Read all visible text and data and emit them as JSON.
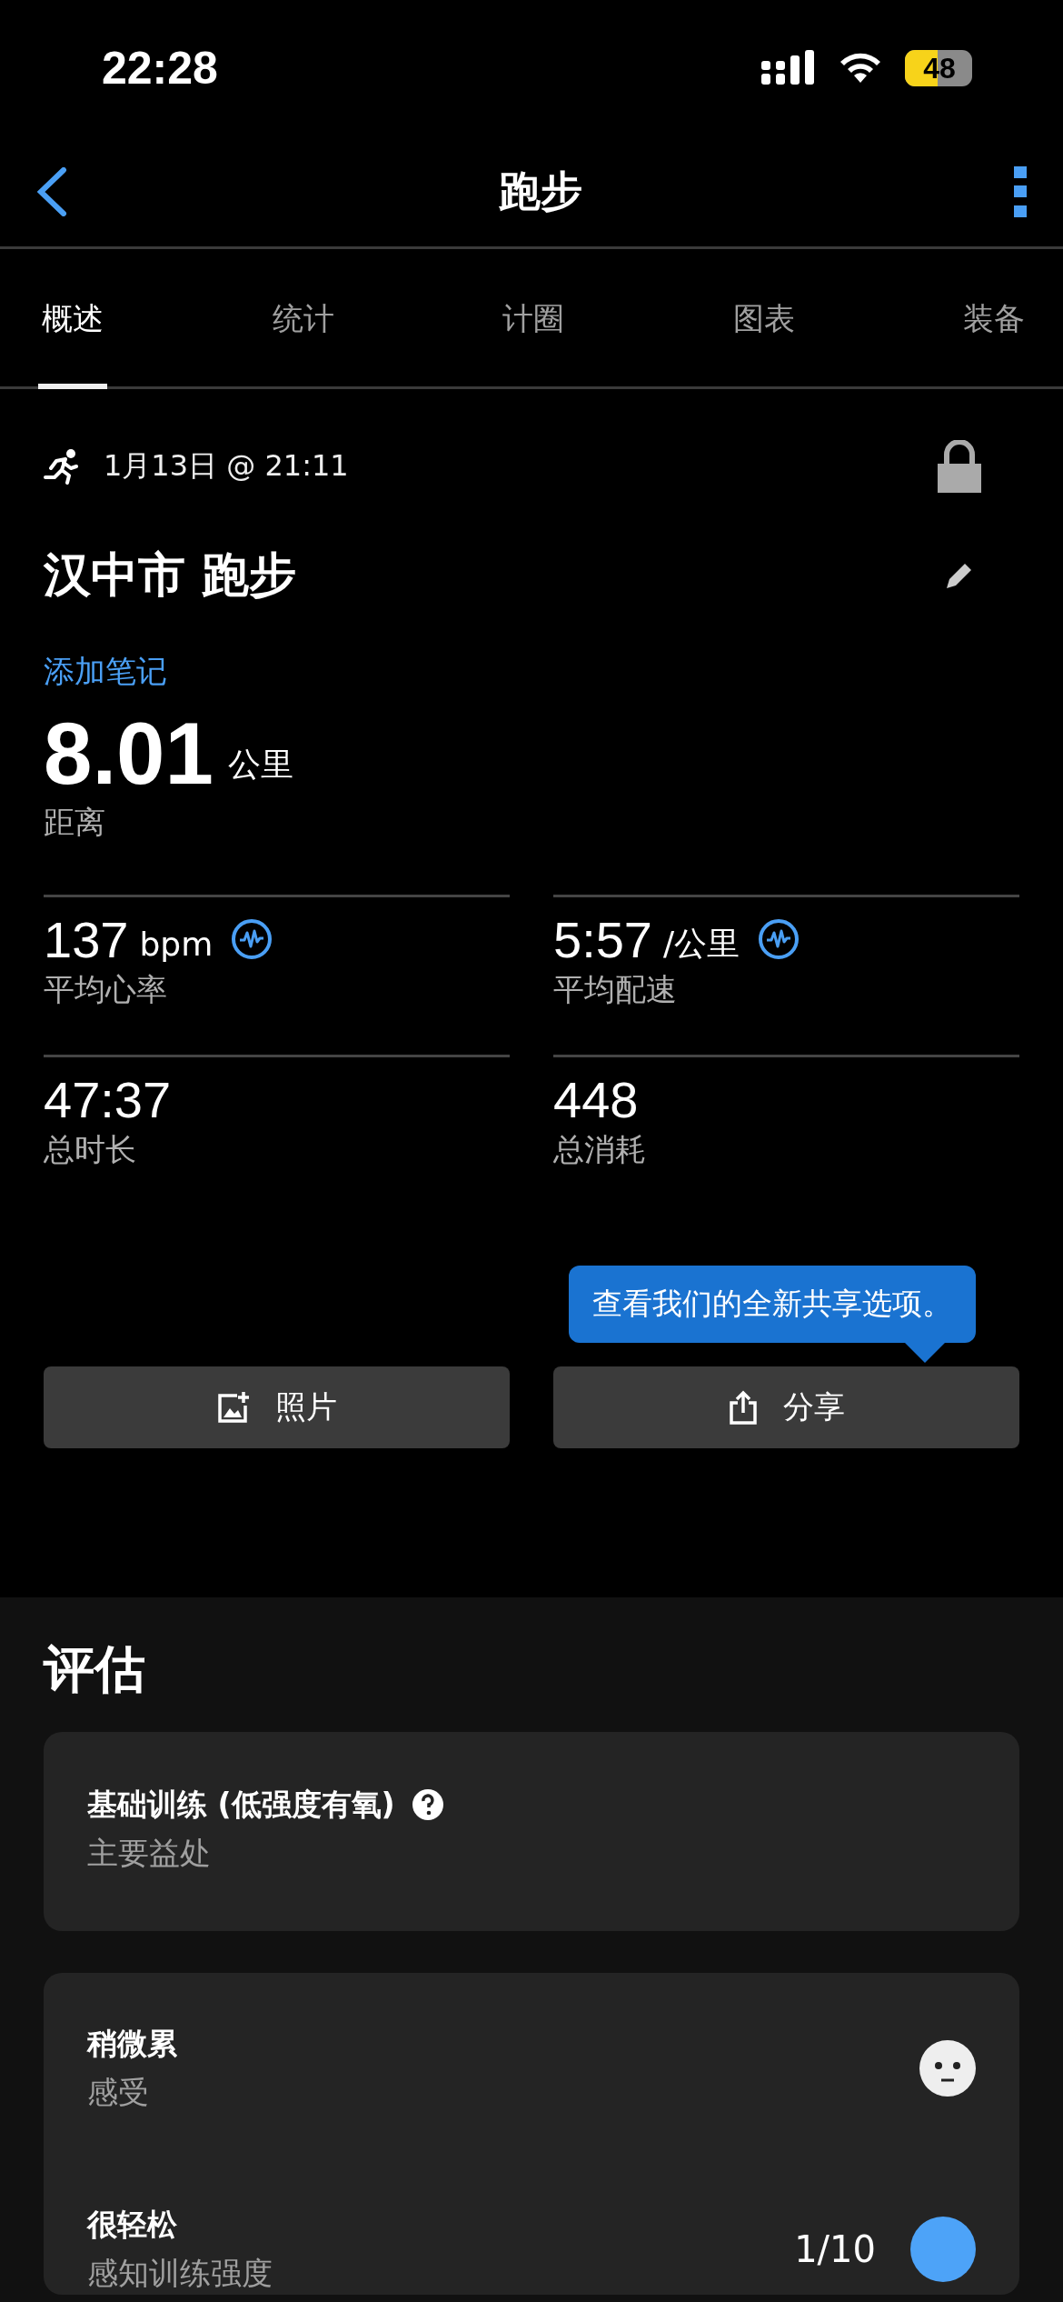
{
  "status_bar": {
    "time": "22:28",
    "battery": "48"
  },
  "nav": {
    "title": "跑步"
  },
  "tabs": [
    {
      "label": "概述",
      "selected": true
    },
    {
      "label": "统计",
      "selected": false
    },
    {
      "label": "计圈",
      "selected": false
    },
    {
      "label": "图表",
      "selected": false
    },
    {
      "label": "装备",
      "selected": false
    }
  ],
  "activity": {
    "datetime": "1月13日 @ 21:11",
    "title": "汉中市 跑步",
    "add_note": "添加笔记",
    "distance": "8.01",
    "distance_unit": "公里",
    "distance_label": "距离"
  },
  "metrics": [
    {
      "value": "137",
      "unit": "bpm",
      "label": "平均心率",
      "chart_link": true
    },
    {
      "value": "5:57",
      "unit": "/公里",
      "label": "平均配速",
      "chart_link": true
    },
    {
      "value": "47:37",
      "label": "总时长",
      "chart_link": false
    },
    {
      "value": "448",
      "label": "总消耗",
      "chart_link": false
    }
  ],
  "tooltip": "查看我们的全新共享选项。",
  "buttons": [
    {
      "kind": "photo",
      "label": "照片"
    },
    {
      "kind": "share",
      "label": "分享"
    }
  ],
  "evaluation": {
    "heading": "评估",
    "benefit": {
      "value": "基础训练 (低强度有氧)",
      "label": "主要益处"
    },
    "feel": {
      "value": "稍微累",
      "label": "感受"
    },
    "effort": {
      "value": "很轻松",
      "label": "感知训练强度",
      "score": "1/10"
    }
  }
}
